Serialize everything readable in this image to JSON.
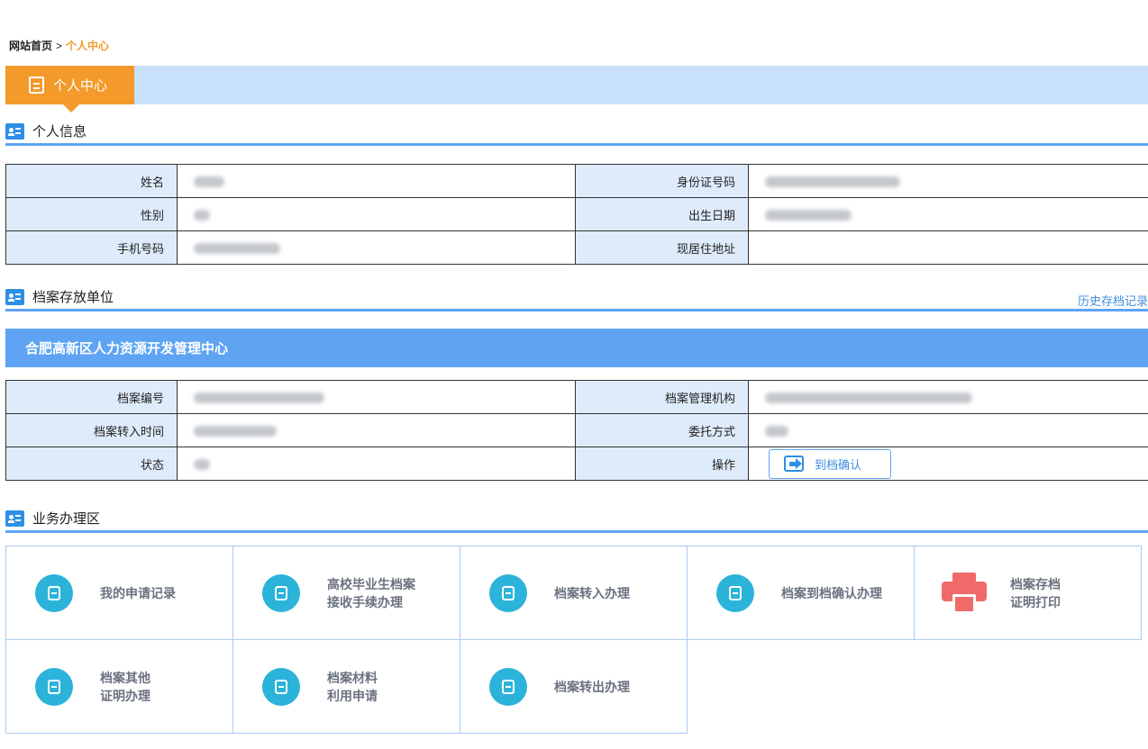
{
  "breadcrumb": {
    "home": "网站首页",
    "separator": ">",
    "current": "个人中心"
  },
  "tab": {
    "label": "个人中心"
  },
  "personal": {
    "title": "个人信息",
    "rows": [
      {
        "l1": "姓名",
        "l2": "身份证号码"
      },
      {
        "l1": "性别",
        "l2": "出生日期"
      },
      {
        "l1": "手机号码",
        "l2": "现居住地址"
      }
    ]
  },
  "archive": {
    "title": "档案存放单位",
    "history_link": "历史存档记录",
    "org_name": "合肥高新区人力资源开发管理中心",
    "rows": [
      {
        "l1": "档案编号",
        "l2": "档案管理机构"
      },
      {
        "l1": "档案转入时间",
        "l2": "委托方式"
      },
      {
        "l1": "状态",
        "l2": "操作"
      }
    ],
    "confirm_button": "到档确认"
  },
  "business": {
    "title": "业务办理区",
    "items": [
      {
        "line1": "我的申请记录",
        "line2": "",
        "icon": "record-icon"
      },
      {
        "line1": "高校毕业生档案",
        "line2": "接收手续办理",
        "icon": "edit-icon"
      },
      {
        "line1": "档案转入办理",
        "line2": "",
        "icon": "edit-icon"
      },
      {
        "line1": "档案到档确认办理",
        "line2": "",
        "icon": "check-doc-icon"
      },
      {
        "line1": "档案存档",
        "line2": "证明打印",
        "icon": "printer-icon"
      },
      {
        "line1": "档案其他",
        "line2": "证明办理",
        "icon": "search-doc-icon"
      },
      {
        "line1": "档案材料",
        "line2": "利用申请",
        "icon": "document-icon"
      },
      {
        "line1": "档案转出办理",
        "line2": "",
        "icon": "export-icon"
      }
    ]
  },
  "colors": {
    "accent": "#f39a2b",
    "primary": "#5ea4f3",
    "light": "#c9e0fb",
    "label_bg": "#deebfb",
    "icon_circle": "#2cb3d9",
    "printer": "#f06a6a"
  }
}
